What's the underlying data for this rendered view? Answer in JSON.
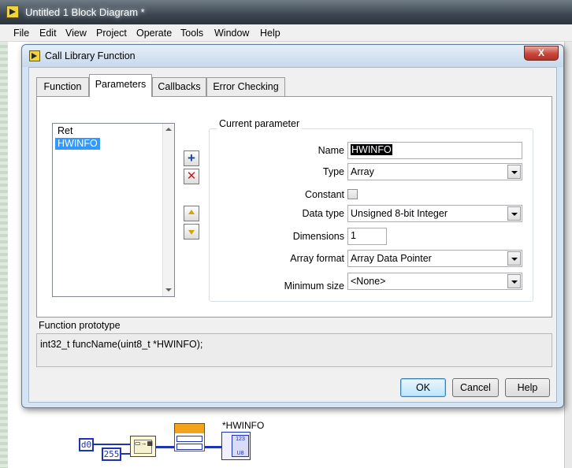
{
  "window": {
    "title": "Untitled 1 Block Diagram *"
  },
  "menu": [
    "File",
    "Edit",
    "View",
    "Project",
    "Operate",
    "Tools",
    "Window",
    "Help"
  ],
  "dialog": {
    "title": "Call Library Function",
    "close_label": "X",
    "tabs": [
      "Function",
      "Parameters",
      "Callbacks",
      "Error Checking"
    ],
    "active_tab": "Parameters",
    "params": [
      "Ret",
      "HWINFO"
    ],
    "selected_param": "HWINFO",
    "current_parameter": {
      "group_title": "Current parameter",
      "name_label": "Name",
      "name_value": "HWINFO",
      "type_label": "Type",
      "type_value": "Array",
      "constant_label": "Constant",
      "constant_checked": false,
      "data_type_label": "Data type",
      "data_type_value": "Unsigned 8-bit Integer",
      "dimensions_label": "Dimensions",
      "dimensions_value": "1",
      "array_format_label": "Array format",
      "array_format_value": "Array Data Pointer",
      "min_size_label": "Minimum size",
      "min_size_value": "<None>"
    },
    "prototype_label": "Function prototype",
    "prototype_text": "int32_t funcName(uint8_t *HWINFO);",
    "buttons": {
      "ok": "OK",
      "cancel": "Cancel",
      "help": "Help"
    }
  },
  "diagram": {
    "const_d0": "d0",
    "const_255": "255",
    "indicator_label": "*HWINFO",
    "indicator_type": "U8"
  }
}
